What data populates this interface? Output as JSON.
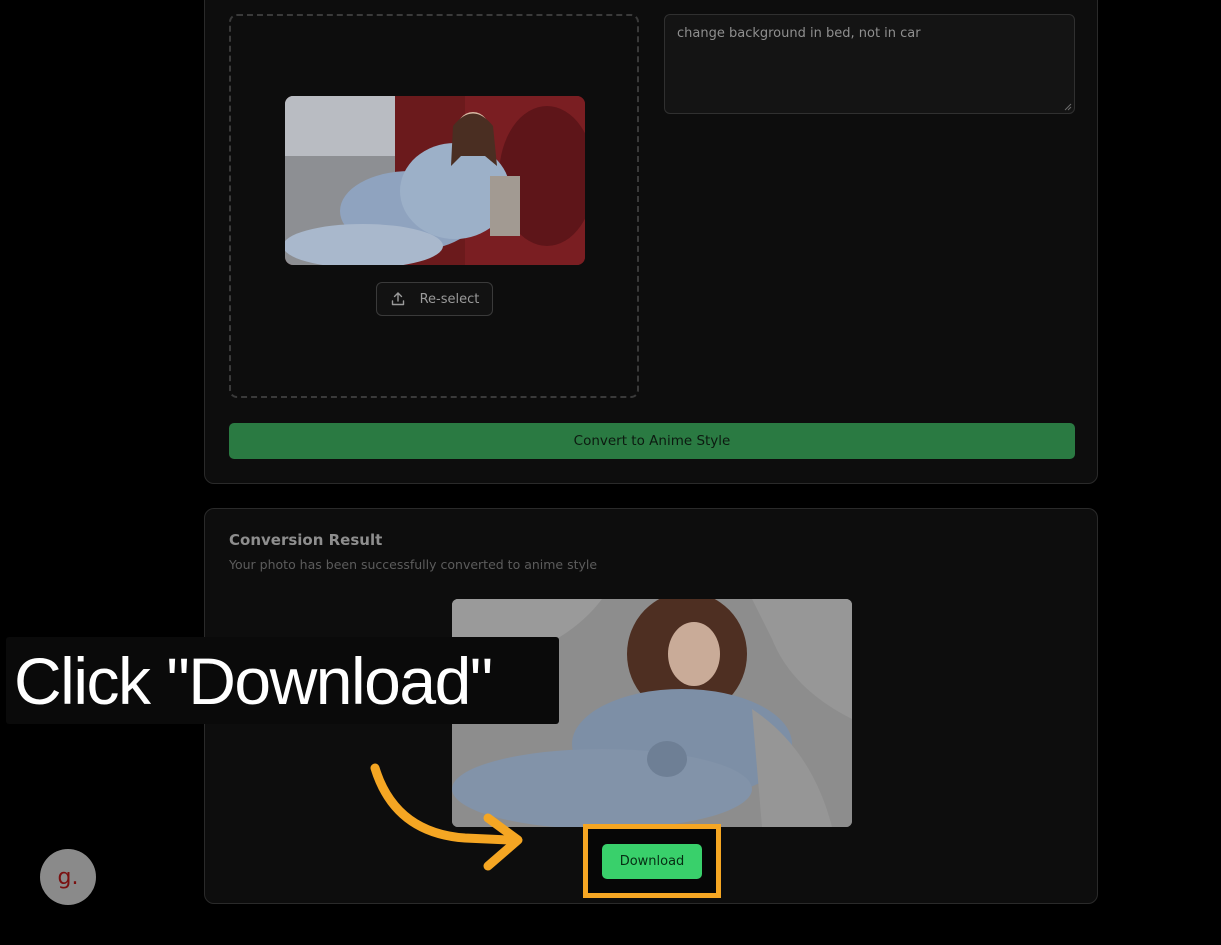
{
  "upload": {
    "reselect_label": "Re-select",
    "prompt_value": "change background in bed, not in car",
    "convert_label": "Convert to Anime Style"
  },
  "result": {
    "title": "Conversion Result",
    "subtitle": "Your photo has been successfully converted to anime style",
    "download_label": "Download"
  },
  "overlay": {
    "instruction": "Click \"Download\"",
    "avatar_glyph": "g."
  },
  "icons": {
    "reselect": "upload-icon",
    "pointer": "curved-arrow-icon"
  },
  "colors": {
    "convert_button": "#2a7a42",
    "download_button": "#39d06b",
    "highlight": "#f5a623"
  }
}
